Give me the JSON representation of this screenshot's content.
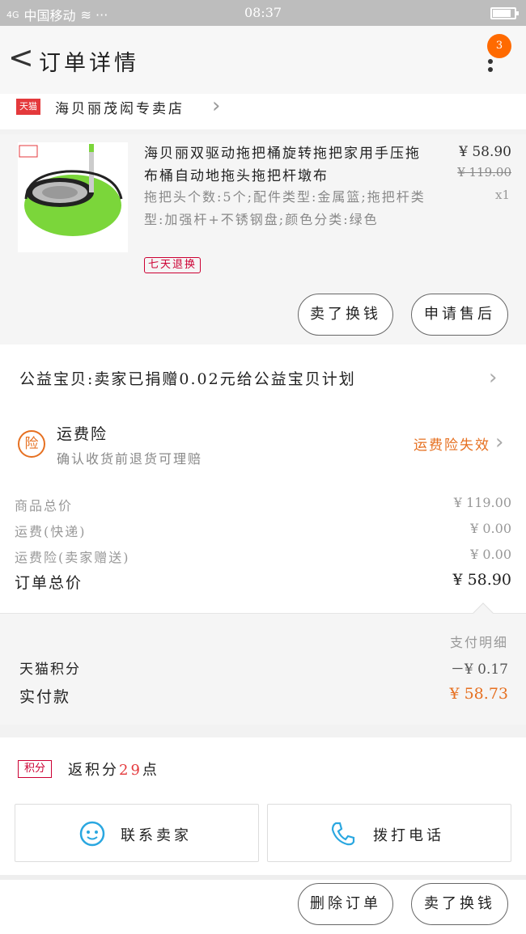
{
  "status_bar": {
    "carrier": "中国移动",
    "time": "08:37",
    "signal": "4G",
    "battery_level": 0.85
  },
  "header": {
    "title": "订单详情",
    "badge_count": "3"
  },
  "store": {
    "logo_text": "天猫",
    "name": "海贝丽茂闳专卖店"
  },
  "product": {
    "name": "海贝丽双驱动拖把桶旋转拖把家用手压拖布桶自动地拖头拖把杆墩布",
    "spec": "拖把头个数:5个;配件类型:金属篮;拖把杆类型:加强杆+不锈钢盘;颜色分类:绿色",
    "tag": "七天退换",
    "price": "¥ 58.90",
    "original_price": "¥ 119.00",
    "quantity": "x1",
    "btn_confirm": "卖了换钱",
    "btn_aftersale": "申请售后"
  },
  "charity": {
    "text": "公益宝贝:卖家已捐赠0.02元给公益宝贝计划"
  },
  "freight_insurance": {
    "icon_text": "险",
    "title": "运费险",
    "subtitle": "确认收货前退货可理赔",
    "status": "运费险失效"
  },
  "costs": {
    "goods_label": "商品总价",
    "goods_value": "¥ 119.00",
    "shipping_label": "运费(快递)",
    "shipping_value": "¥ 0.00",
    "insurance_label": "运费险(卖家赠送)",
    "insurance_value": "¥ 0.00",
    "total_label": "订单总价",
    "total_value": "¥ 58.90"
  },
  "payment": {
    "detail_label": "支付明细",
    "points_label": "天猫积分",
    "points_value": "－¥ 0.17",
    "paid_label": "实付款",
    "paid_value": "¥ 58.73"
  },
  "rebate": {
    "badge": "积分",
    "prefix": "返积分",
    "points": "29",
    "suffix": "点"
  },
  "contact": {
    "seller_label": "联系卖家",
    "phone_label": "拨打电话"
  },
  "footer": {
    "delete_label": "删除订单",
    "sell_label": "卖了换钱"
  },
  "colors": {
    "accent_orange": "#e67021",
    "tmall_red": "#e4393c",
    "badge_orange": "#ff6a00"
  }
}
